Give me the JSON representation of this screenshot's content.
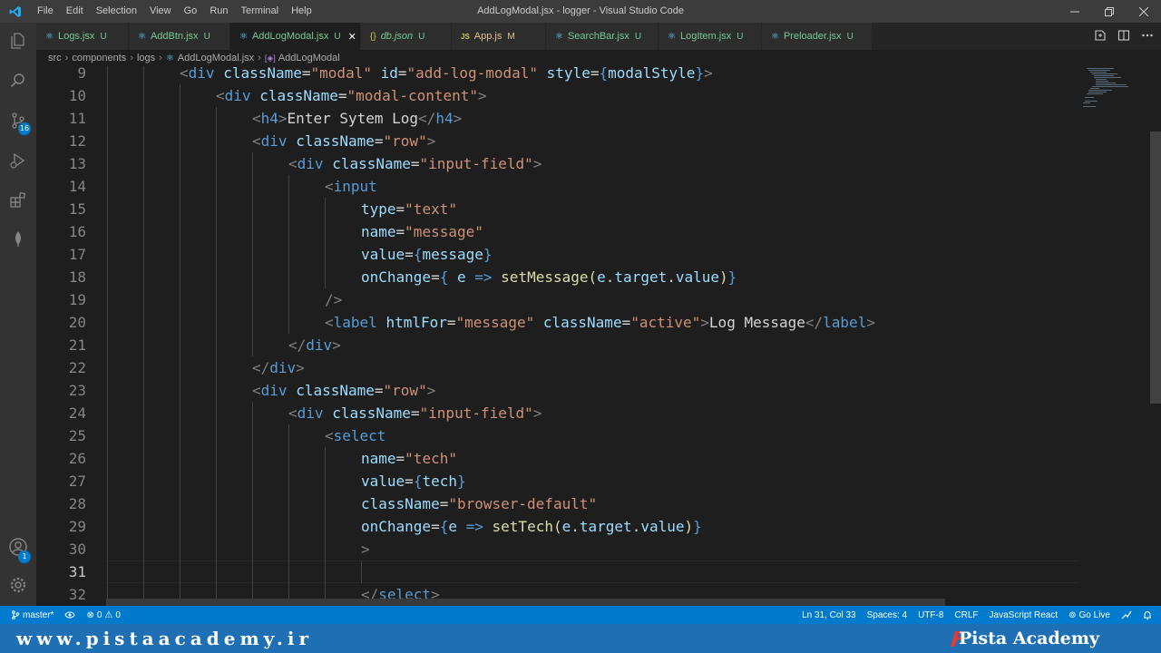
{
  "window": {
    "title": "AddLogModal.jsx - logger - Visual Studio Code",
    "menu": [
      "File",
      "Edit",
      "Selection",
      "View",
      "Go",
      "Run",
      "Terminal",
      "Help"
    ]
  },
  "activity": {
    "scm_badge": "16",
    "account_badge": "1"
  },
  "tabs": [
    {
      "icon": "⚛",
      "name": "Logs.jsx",
      "status": "U"
    },
    {
      "icon": "⚛",
      "name": "AddBtn.jsx",
      "status": "U"
    },
    {
      "icon": "⚛",
      "name": "AddLogModal.jsx",
      "status": "U",
      "close": "✕"
    },
    {
      "icon": "{}",
      "name": "db.json",
      "status": "U"
    },
    {
      "icon": "JS",
      "name": "App.js",
      "status": "M"
    },
    {
      "icon": "⚛",
      "name": "SearchBar.jsx",
      "status": "U"
    },
    {
      "icon": "⚛",
      "name": "LogItem.jsx",
      "status": "U"
    },
    {
      "icon": "⚛",
      "name": "Preloader.jsx",
      "status": "U"
    }
  ],
  "breadcrumb": [
    "src",
    "components",
    "logs",
    "AddLogModal.jsx",
    "AddLogModal"
  ],
  "editor": {
    "lines": [
      {
        "n": "9",
        "indent": 2,
        "tokens": [
          [
            "tk-punct",
            "<"
          ],
          [
            "tk-tag",
            "div"
          ],
          [
            "tk-text",
            " "
          ],
          [
            "tk-attr",
            "className"
          ],
          [
            "tk-text",
            "="
          ],
          [
            "tk-str",
            "\"modal\""
          ],
          [
            "tk-text",
            " "
          ],
          [
            "tk-attr",
            "id"
          ],
          [
            "tk-text",
            "="
          ],
          [
            "tk-str",
            "\"add-log-modal\""
          ],
          [
            "tk-text",
            " "
          ],
          [
            "tk-attr",
            "style"
          ],
          [
            "tk-text",
            "="
          ],
          [
            "tk-brace",
            "{"
          ],
          [
            "tk-attr",
            "modalStyle"
          ],
          [
            "tk-brace",
            "}"
          ],
          [
            "tk-punct",
            ">"
          ]
        ]
      },
      {
        "n": "10",
        "indent": 3,
        "tokens": [
          [
            "tk-punct",
            "<"
          ],
          [
            "tk-tag",
            "div"
          ],
          [
            "tk-text",
            " "
          ],
          [
            "tk-attr",
            "className"
          ],
          [
            "tk-text",
            "="
          ],
          [
            "tk-str",
            "\"modal-content\""
          ],
          [
            "tk-punct",
            ">"
          ]
        ]
      },
      {
        "n": "11",
        "indent": 4,
        "tokens": [
          [
            "tk-punct",
            "<"
          ],
          [
            "tk-tag",
            "h4"
          ],
          [
            "tk-punct",
            ">"
          ],
          [
            "tk-text",
            "Enter Sytem Log"
          ],
          [
            "tk-punct",
            "</"
          ],
          [
            "tk-tag",
            "h4"
          ],
          [
            "tk-punct",
            ">"
          ]
        ]
      },
      {
        "n": "12",
        "indent": 4,
        "tokens": [
          [
            "tk-punct",
            "<"
          ],
          [
            "tk-tag",
            "div"
          ],
          [
            "tk-text",
            " "
          ],
          [
            "tk-attr",
            "className"
          ],
          [
            "tk-text",
            "="
          ],
          [
            "tk-str",
            "\"row\""
          ],
          [
            "tk-punct",
            ">"
          ]
        ]
      },
      {
        "n": "13",
        "indent": 5,
        "tokens": [
          [
            "tk-punct",
            "<"
          ],
          [
            "tk-tag",
            "div"
          ],
          [
            "tk-text",
            " "
          ],
          [
            "tk-attr",
            "className"
          ],
          [
            "tk-text",
            "="
          ],
          [
            "tk-str",
            "\"input-field\""
          ],
          [
            "tk-punct",
            ">"
          ]
        ]
      },
      {
        "n": "14",
        "indent": 6,
        "tokens": [
          [
            "tk-punct",
            "<"
          ],
          [
            "tk-tag",
            "input"
          ]
        ]
      },
      {
        "n": "15",
        "indent": 7,
        "tokens": [
          [
            "tk-attr",
            "type"
          ],
          [
            "tk-text",
            "="
          ],
          [
            "tk-str",
            "\"text\""
          ]
        ]
      },
      {
        "n": "16",
        "indent": 7,
        "tokens": [
          [
            "tk-attr",
            "name"
          ],
          [
            "tk-text",
            "="
          ],
          [
            "tk-str",
            "\"message\""
          ]
        ]
      },
      {
        "n": "17",
        "indent": 7,
        "tokens": [
          [
            "tk-attr",
            "value"
          ],
          [
            "tk-text",
            "="
          ],
          [
            "tk-brace",
            "{"
          ],
          [
            "tk-attr",
            "message"
          ],
          [
            "tk-brace",
            "}"
          ]
        ]
      },
      {
        "n": "18",
        "indent": 7,
        "tokens": [
          [
            "tk-attr",
            "onChange"
          ],
          [
            "tk-text",
            "="
          ],
          [
            "tk-brace",
            "{"
          ],
          [
            "tk-text",
            " "
          ],
          [
            "tk-attr",
            "e"
          ],
          [
            "tk-text",
            " "
          ],
          [
            "tk-op",
            "=>"
          ],
          [
            "tk-text",
            " "
          ],
          [
            "tk-fn",
            "setMessage"
          ],
          [
            "tk-fn",
            "("
          ],
          [
            "tk-attr",
            "e"
          ],
          [
            "tk-text",
            "."
          ],
          [
            "tk-attr",
            "target"
          ],
          [
            "tk-text",
            "."
          ],
          [
            "tk-attr",
            "value"
          ],
          [
            "tk-fn",
            ")"
          ],
          [
            "tk-brace",
            "}"
          ]
        ]
      },
      {
        "n": "19",
        "indent": 6,
        "tokens": [
          [
            "tk-punct",
            "/>"
          ]
        ]
      },
      {
        "n": "20",
        "indent": 6,
        "tokens": [
          [
            "tk-punct",
            "<"
          ],
          [
            "tk-tag",
            "label"
          ],
          [
            "tk-text",
            " "
          ],
          [
            "tk-attr",
            "htmlFor"
          ],
          [
            "tk-text",
            "="
          ],
          [
            "tk-str",
            "\"message\""
          ],
          [
            "tk-text",
            " "
          ],
          [
            "tk-attr",
            "className"
          ],
          [
            "tk-text",
            "="
          ],
          [
            "tk-str",
            "\"active\""
          ],
          [
            "tk-punct",
            ">"
          ],
          [
            "tk-text",
            "Log Message"
          ],
          [
            "tk-punct",
            "</"
          ],
          [
            "tk-tag",
            "label"
          ],
          [
            "tk-punct",
            ">"
          ]
        ]
      },
      {
        "n": "21",
        "indent": 5,
        "tokens": [
          [
            "tk-punct",
            "</"
          ],
          [
            "tk-tag",
            "div"
          ],
          [
            "tk-punct",
            ">"
          ]
        ]
      },
      {
        "n": "22",
        "indent": 4,
        "tokens": [
          [
            "tk-punct",
            "</"
          ],
          [
            "tk-tag",
            "div"
          ],
          [
            "tk-punct",
            ">"
          ]
        ]
      },
      {
        "n": "23",
        "indent": 4,
        "tokens": [
          [
            "tk-punct",
            "<"
          ],
          [
            "tk-tag",
            "div"
          ],
          [
            "tk-text",
            " "
          ],
          [
            "tk-attr",
            "className"
          ],
          [
            "tk-text",
            "="
          ],
          [
            "tk-str",
            "\"row\""
          ],
          [
            "tk-punct",
            ">"
          ]
        ]
      },
      {
        "n": "24",
        "indent": 5,
        "tokens": [
          [
            "tk-punct",
            "<"
          ],
          [
            "tk-tag",
            "div"
          ],
          [
            "tk-text",
            " "
          ],
          [
            "tk-attr",
            "className"
          ],
          [
            "tk-text",
            "="
          ],
          [
            "tk-str",
            "\"input-field\""
          ],
          [
            "tk-punct",
            ">"
          ]
        ]
      },
      {
        "n": "25",
        "indent": 6,
        "tokens": [
          [
            "tk-punct",
            "<"
          ],
          [
            "tk-tag",
            "select"
          ]
        ]
      },
      {
        "n": "26",
        "indent": 7,
        "tokens": [
          [
            "tk-attr",
            "name"
          ],
          [
            "tk-text",
            "="
          ],
          [
            "tk-str",
            "\"tech\""
          ]
        ]
      },
      {
        "n": "27",
        "indent": 7,
        "tokens": [
          [
            "tk-attr",
            "value"
          ],
          [
            "tk-text",
            "="
          ],
          [
            "tk-brace",
            "{"
          ],
          [
            "tk-attr",
            "tech"
          ],
          [
            "tk-brace",
            "}"
          ]
        ]
      },
      {
        "n": "28",
        "indent": 7,
        "tokens": [
          [
            "tk-attr",
            "className"
          ],
          [
            "tk-text",
            "="
          ],
          [
            "tk-str",
            "\"browser-default\""
          ]
        ]
      },
      {
        "n": "29",
        "indent": 7,
        "tokens": [
          [
            "tk-attr",
            "onChange"
          ],
          [
            "tk-text",
            "="
          ],
          [
            "tk-brace",
            "{"
          ],
          [
            "tk-attr",
            "e"
          ],
          [
            "tk-text",
            " "
          ],
          [
            "tk-op",
            "=>"
          ],
          [
            "tk-text",
            " "
          ],
          [
            "tk-fn",
            "setTech"
          ],
          [
            "tk-fn",
            "("
          ],
          [
            "tk-attr",
            "e"
          ],
          [
            "tk-text",
            "."
          ],
          [
            "tk-attr",
            "target"
          ],
          [
            "tk-text",
            "."
          ],
          [
            "tk-attr",
            "value"
          ],
          [
            "tk-fn",
            ")"
          ],
          [
            "tk-brace",
            "}"
          ]
        ]
      },
      {
        "n": "30",
        "indent": 7,
        "tokens": [
          [
            "tk-punct",
            ">"
          ]
        ]
      },
      {
        "n": "31",
        "indent": 0,
        "tokens": [],
        "current": true
      },
      {
        "n": "32",
        "indent": 7,
        "tokens": [
          [
            "tk-punct",
            "</"
          ],
          [
            "tk-tag",
            "select"
          ],
          [
            "tk-punct",
            ">"
          ]
        ]
      }
    ]
  },
  "statusbar": {
    "branch": "master*",
    "errors": "0",
    "warnings": "0",
    "position": "Ln 31, Col 33",
    "spaces": "Spaces: 4",
    "encoding": "UTF-8",
    "eol": "CRLF",
    "language": "JavaScript React",
    "golive": "Go Live"
  },
  "watermark": {
    "url": "www.pistaacademy.ir",
    "brand": "Pista Academy"
  },
  "colors": {
    "accent": "#007acc",
    "titlebar": "#3c3c3c",
    "editor_bg": "#1e1e1e",
    "watermark_bg": "#1f6fb5"
  }
}
